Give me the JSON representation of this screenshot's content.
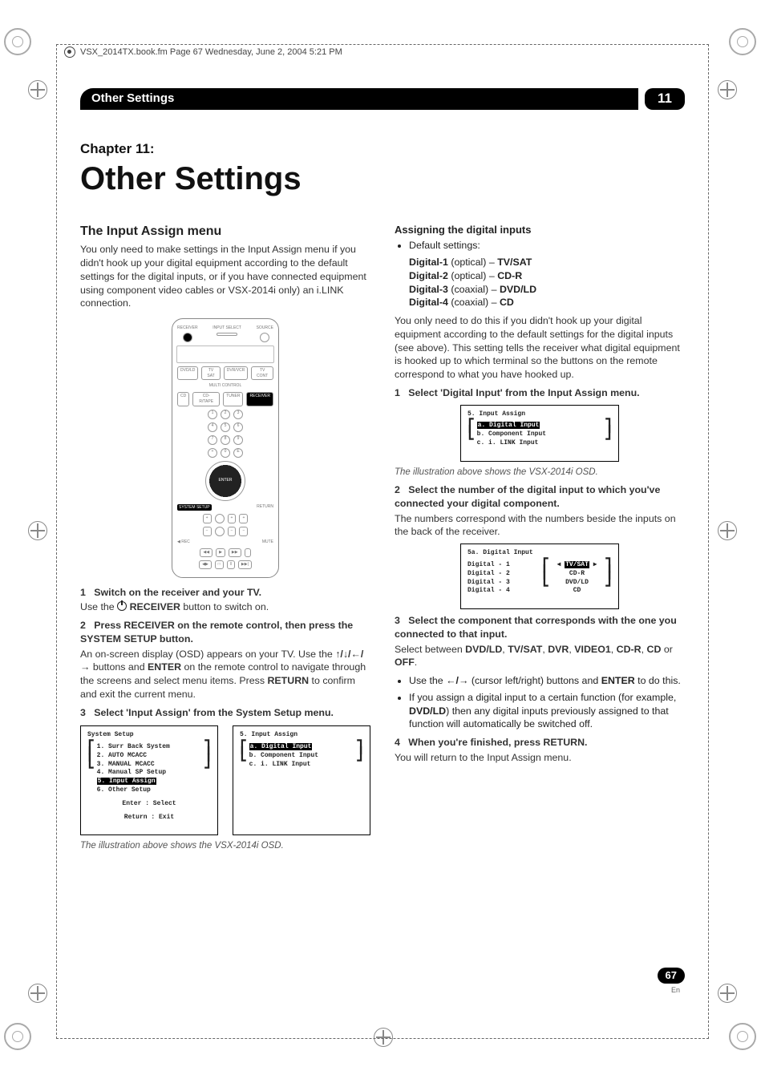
{
  "meta": {
    "bookline": "VSX_2014TX.book.fm  Page 67  Wednesday, June 2, 2004  5:21 PM"
  },
  "header": {
    "section_title": "Other Settings",
    "chapter_number": "11"
  },
  "chapter": {
    "label": "Chapter 11:",
    "title": "Other Settings"
  },
  "left": {
    "h_input_assign": "The Input Assign menu",
    "p_intro": "You only need to make settings in the Input Assign menu if you didn't hook up your digital equipment according to the default settings for the digital inputs, or if you have connected equipment using component video cables or VSX-2014i only) an i.LINK connection.",
    "remote_labels": {
      "receiver": "RECEIVER",
      "input_select": "INPUT SELECT",
      "source": "SOURCE",
      "multi_control": "MULTI CONTROL",
      "receiver_btn": "RECEIVER",
      "enter": "ENTER",
      "system_setup": "SYSTEM SETUP",
      "return": "RETURN",
      "mute": "MUTE"
    },
    "step1_num": "1",
    "step1_txt": "Switch on the receiver and your TV.",
    "step1_body_a": "Use the ",
    "step1_body_b": " RECEIVER",
    "step1_body_c": " button to switch on.",
    "step2_num": "2",
    "step2_txt": "Press RECEIVER on the remote control, then press the SYSTEM SETUP button.",
    "step2_body_a": "An on-screen display (OSD) appears on your TV. Use the ",
    "step2_arrows": "↑/↓/←/→",
    "step2_body_b": " buttons and ",
    "step2_enter": "ENTER",
    "step2_body_c": " on the remote control to navigate through the screens and select menu items. Press ",
    "step2_return": "RETURN",
    "step2_body_d": " to confirm and exit the current menu.",
    "step3_num": "3",
    "step3_txt": "Select 'Input Assign' from the System Setup menu.",
    "osd1": {
      "title": "System Setup",
      "items": [
        "1. Surr Back System",
        "2. AUTO MCACC",
        "3. MANUAL MCACC",
        "4. Manual SP Setup",
        "5. Input Assign",
        "6. Other Setup"
      ],
      "highlight_index": 4,
      "foot1": "Enter  : Select",
      "foot2": "Return : Exit"
    },
    "osd2": {
      "title": "5. Input Assign",
      "items": [
        "a. Digital Input",
        "b. Component Input",
        "c. i. LINK Input"
      ],
      "highlight_index": 0
    },
    "illus_caption": "The illustration above shows the VSX-2014i OSD."
  },
  "right": {
    "h_assign_digital": "Assigning the digital inputs",
    "bul_default": "Default settings:",
    "defaults": [
      {
        "label": "Digital-1",
        "type": " (optical) – ",
        "val": "TV/SAT"
      },
      {
        "label": "Digital-2",
        "type": " (optical) – ",
        "val": "CD-R"
      },
      {
        "label": "Digital-3",
        "type": " (coaxial) – ",
        "val": "DVD/LD"
      },
      {
        "label": "Digital-4",
        "type": " (coaxial) – ",
        "val": "CD"
      }
    ],
    "p_intro": "You only need to do this if you didn't hook up your digital equipment according to the default settings for the digital inputs (see above). This setting tells the receiver what digital equipment is hooked up to which terminal so the buttons on the remote correspond to what you have hooked up.",
    "step1_num": "1",
    "step1_txt": "Select 'Digital Input' from the Input Assign menu.",
    "osd3": {
      "title": "5. Input Assign",
      "items": [
        "a. Digital Input",
        "b. Component Input",
        "c. i. LINK Input"
      ],
      "highlight_index": 0
    },
    "illus_caption": "The illustration above shows the VSX-2014i OSD.",
    "step2_num": "2",
    "step2_txt": "Select the number of the digital input to which you've connected your digital component.",
    "step2_body": "The numbers correspond with the numbers beside the inputs on the back of the receiver.",
    "osd4": {
      "title": "5a. Digital Input",
      "rows": [
        {
          "l": "Digital - 1",
          "r": "TV/SAT",
          "hl": true
        },
        {
          "l": "Digital - 2",
          "r": "CD-R"
        },
        {
          "l": "Digital - 3",
          "r": "DVD/LD"
        },
        {
          "l": "Digital - 4",
          "r": "CD"
        }
      ]
    },
    "step3_num": "3",
    "step3_txt": "Select the component that corresponds with the one you connected to that input.",
    "step3_body_a": "Select between ",
    "opts": [
      "DVD/LD",
      "TV/SAT",
      "DVR",
      "VIDEO1",
      "CD-R",
      "CD",
      "OFF"
    ],
    "or_word": " or ",
    "comma": ", ",
    "period": ".",
    "bul1_a": "Use the ",
    "bul1_arrows": "←/→",
    "bul1_b": " (cursor left/right) buttons and ",
    "bul1_enter": "ENTER",
    "bul1_c": " to do this.",
    "bul2_a": "If you assign a digital input to a certain function (for example, ",
    "bul2_dvd": "DVD/LD",
    "bul2_b": ") then any digital inputs previously assigned to that function will automatically be switched off.",
    "step4_num": "4",
    "step4_txt": "When you're finished, press RETURN.",
    "step4_body": "You will return to the Input Assign menu."
  },
  "footer": {
    "page_num": "67",
    "lang": "En"
  }
}
